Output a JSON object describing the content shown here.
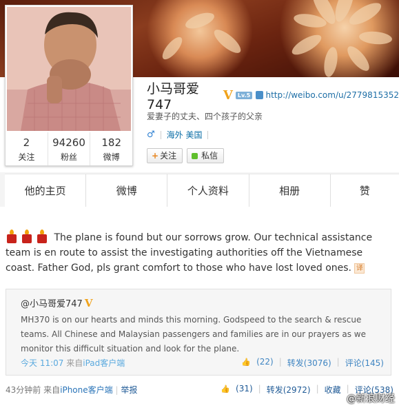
{
  "profile": {
    "name": "小马哥爱747",
    "verified_mark": "V",
    "level_badge": "Lv.5",
    "url": "http://weibo.com/u/2779815352",
    "bio": "爱妻子的丈夫、四个孩子的父亲",
    "gender_symbol": "♂",
    "location": "海外 美国",
    "follow_label": "关注",
    "follow_plus": "+",
    "message_label": "私信"
  },
  "stats": [
    {
      "value": "2",
      "label": "关注"
    },
    {
      "value": "94260",
      "label": "粉丝"
    },
    {
      "value": "182",
      "label": "微博"
    }
  ],
  "tabs": [
    {
      "label": "他的主页"
    },
    {
      "label": "微博"
    },
    {
      "label": "个人资料"
    },
    {
      "label": "相册"
    },
    {
      "label": "赞"
    }
  ],
  "post": {
    "text": "The plane is found but our sorrows grow. Our technical assistance team is en route to assist the investigating authorities off the Vietnamese coast. Father God, pls grant comfort to those who have lost loved ones.",
    "translate_label": "译",
    "time": "43分钟前",
    "from_label": "来自",
    "source": "iPhone客户端",
    "separator": "|",
    "report": "举报",
    "likes": "(31)",
    "repost": "转发(2972)",
    "favorite": "收藏",
    "comments": "评论(538)"
  },
  "repost": {
    "author": "@小马哥爱747",
    "verified_mark": "V",
    "text": "MH370 is on our hearts and minds this morning. Godspeed to the search & rescue teams. All Chinese and Malaysian passengers and families are in our prayers as we monitor this difficult situation and look for the plane.",
    "time": "今天 11:07",
    "from_label": "来自",
    "source": "iPad客户端",
    "likes": "(22)",
    "repost": "转发(3076)",
    "comments": "评论(145)"
  },
  "watermark": "@新浪财经",
  "colors": {
    "accent_blue": "#1d6ea6",
    "verified_gold": "#f0a21a",
    "candle_red": "#c8231b"
  }
}
